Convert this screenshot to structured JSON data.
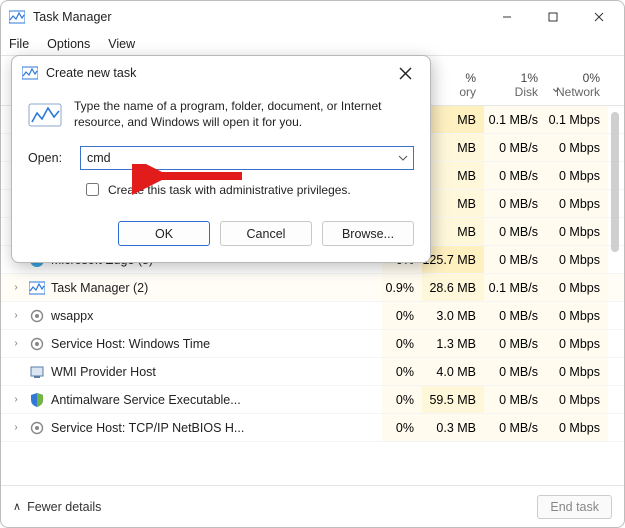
{
  "window": {
    "title": "Task Manager",
    "menus": {
      "file": "File",
      "options": "Options",
      "view": "View"
    }
  },
  "columns": {
    "mem": {
      "pct": "%",
      "label": "ory"
    },
    "disk": {
      "pct": "1%",
      "label": "Disk"
    },
    "net": {
      "pct": "0%",
      "label": "Network"
    }
  },
  "rows": [
    {
      "name": "",
      "cpu": "",
      "mem": "MB",
      "disk": "0.1 MB/s",
      "net": "0.1 Mbps",
      "memClass": "mem-a"
    },
    {
      "name": "",
      "cpu": "",
      "mem": "MB",
      "disk": "0 MB/s",
      "net": "0 Mbps",
      "memClass": "mem-b"
    },
    {
      "name": "",
      "cpu": "",
      "mem": "MB",
      "disk": "0 MB/s",
      "net": "0 Mbps",
      "memClass": "mem-b"
    },
    {
      "name": "",
      "cpu": "",
      "mem": "MB",
      "disk": "0 MB/s",
      "net": "0 Mbps",
      "memClass": "mem-b"
    },
    {
      "name": "",
      "cpu": "",
      "mem": "MB",
      "disk": "0 MB/s",
      "net": "0 Mbps",
      "memClass": "mem-b"
    },
    {
      "name": "Microsoft Edge (8)",
      "cpu": "0%",
      "mem": "125.7 MB",
      "disk": "0 MB/s",
      "net": "0 Mbps",
      "icon": "edge",
      "memClass": "mem-a"
    },
    {
      "name": "Task Manager (2)",
      "cpu": "0.9%",
      "mem": "28.6 MB",
      "disk": "0.1 MB/s",
      "net": "0 Mbps",
      "icon": "tm",
      "memClass": "mem-b",
      "shade": true
    },
    {
      "name": "wsappx",
      "cpu": "0%",
      "mem": "3.0 MB",
      "disk": "0 MB/s",
      "net": "0 Mbps",
      "icon": "gear",
      "memClass": "mem-c"
    },
    {
      "name": "Service Host: Windows Time",
      "cpu": "0%",
      "mem": "1.3 MB",
      "disk": "0 MB/s",
      "net": "0 Mbps",
      "icon": "gear",
      "memClass": "mem-c"
    },
    {
      "name": "WMI Provider Host",
      "cpu": "0%",
      "mem": "4.0 MB",
      "disk": "0 MB/s",
      "net": "0 Mbps",
      "icon": "wmi",
      "memClass": "mem-c",
      "nochev": true
    },
    {
      "name": "Antimalware Service Executable...",
      "cpu": "0%",
      "mem": "59.5 MB",
      "disk": "0 MB/s",
      "net": "0 Mbps",
      "icon": "shield",
      "memClass": "mem-b"
    },
    {
      "name": "Service Host: TCP/IP NetBIOS H...",
      "cpu": "0%",
      "mem": "0.3 MB",
      "disk": "0 MB/s",
      "net": "0 Mbps",
      "icon": "gear",
      "memClass": "mem-c"
    }
  ],
  "footer": {
    "fewer": "Fewer details",
    "endtask": "End task"
  },
  "dialog": {
    "title": "Create new task",
    "desc": "Type the name of a program, folder, document, or Internet resource, and Windows will open it for you.",
    "openLabel": "Open:",
    "openValue": "cmd",
    "adminLabel": "Create this task with administrative privileges.",
    "ok": "OK",
    "cancel": "Cancel",
    "browse": "Browse..."
  }
}
